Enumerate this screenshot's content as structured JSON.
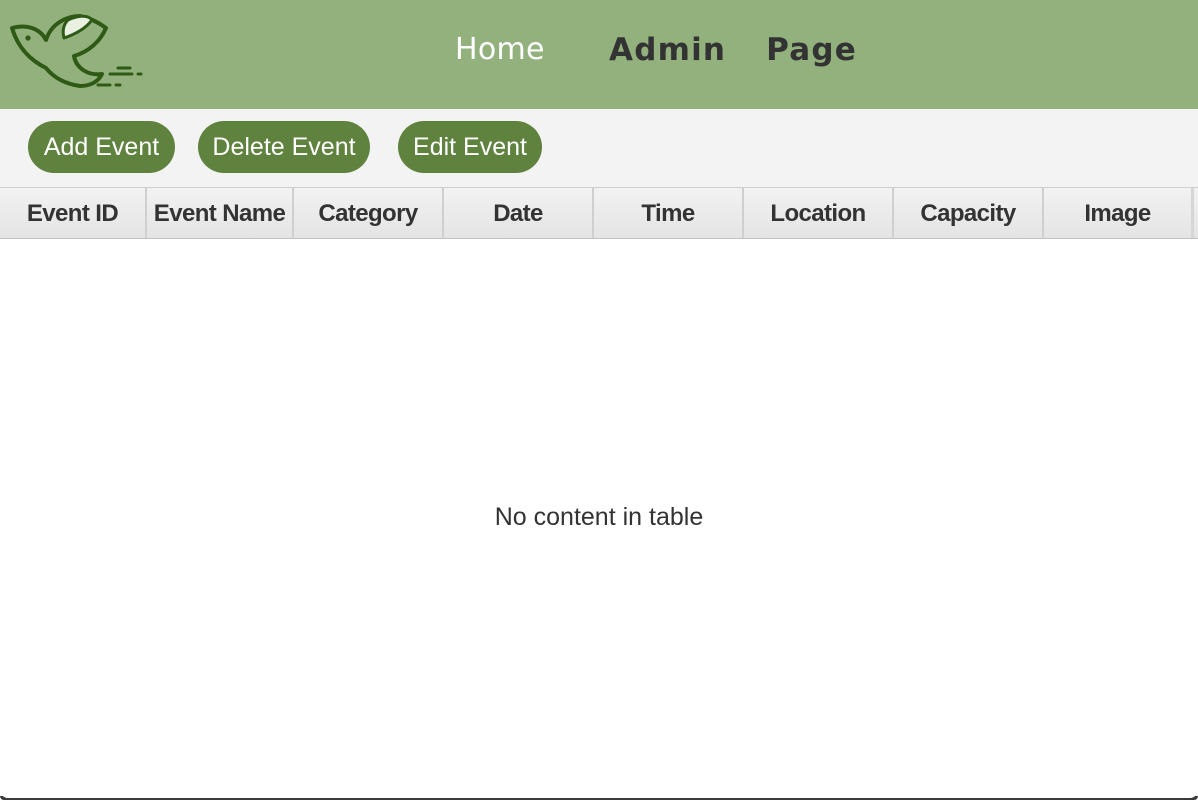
{
  "header": {
    "logo_icon": "dove-logo-icon",
    "nav_home": "Home",
    "page_title": "Admin  Page",
    "background_color": "#93b17c"
  },
  "toolbar": {
    "add_label": "Add Event",
    "delete_label": "Delete Event",
    "edit_label": "Edit Event",
    "button_color": "#5f823e"
  },
  "table": {
    "columns": [
      "Event ID",
      "Event Name",
      "Category",
      "Date",
      "Time",
      "Location",
      "Capacity",
      "Image"
    ],
    "rows": [],
    "placeholder": "No content in table"
  }
}
